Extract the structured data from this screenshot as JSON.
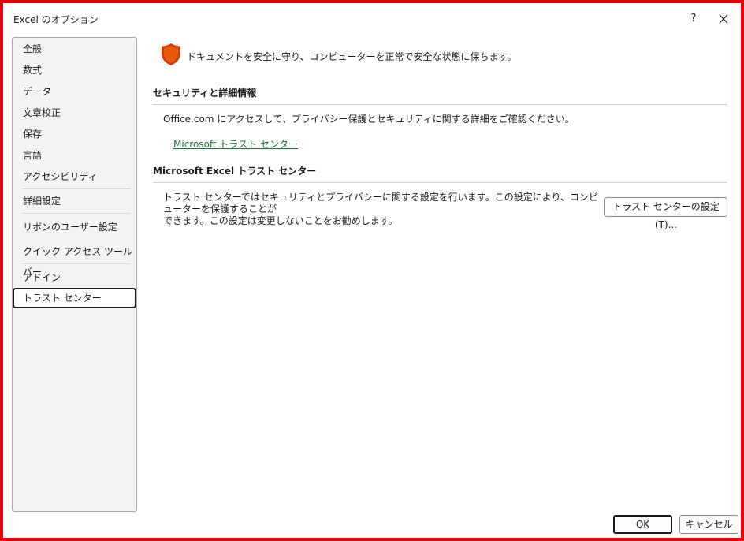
{
  "window": {
    "title": "Excel のオプション",
    "help_label": "?"
  },
  "sidebar": {
    "items": [
      {
        "label": "全般"
      },
      {
        "label": "数式"
      },
      {
        "label": "データ"
      },
      {
        "label": "文章校正"
      },
      {
        "label": "保存"
      },
      {
        "label": "言語"
      },
      {
        "label": "アクセシビリティ"
      },
      {
        "label": "詳細設定"
      },
      {
        "label": "リボンのユーザー設定"
      },
      {
        "label": "クイック アクセス ツール バー"
      },
      {
        "label": "アドイン"
      },
      {
        "label": "トラスト センター",
        "selected": true
      }
    ]
  },
  "main": {
    "intro": "ドキュメントを安全に守り、コンピューターを正常で安全な状態に保ちます。",
    "security_section": {
      "title": "セキュリティと詳細情報",
      "text": "Office.com にアクセスして、プライバシー保護とセキュリティに関する詳細をご確認ください。",
      "link": "Microsoft トラスト センター"
    },
    "trust_section": {
      "title": "Microsoft Excel トラスト センター",
      "text_line1": "トラスト センターではセキュリティとプライバシーに関する設定を行います。この設定により、コンピューターを保護することが",
      "text_line2": "できます。この設定は変更しないことをお勧めします。",
      "button": "トラスト センターの設定(T)..."
    }
  },
  "footer": {
    "ok": "OK",
    "cancel": "キャンセル"
  },
  "colors": {
    "frame_border": "#e8000b",
    "shield": "#d83b01",
    "link": "#1f6f3c"
  },
  "icons": {
    "close": "close-icon",
    "shield": "shield-icon"
  }
}
